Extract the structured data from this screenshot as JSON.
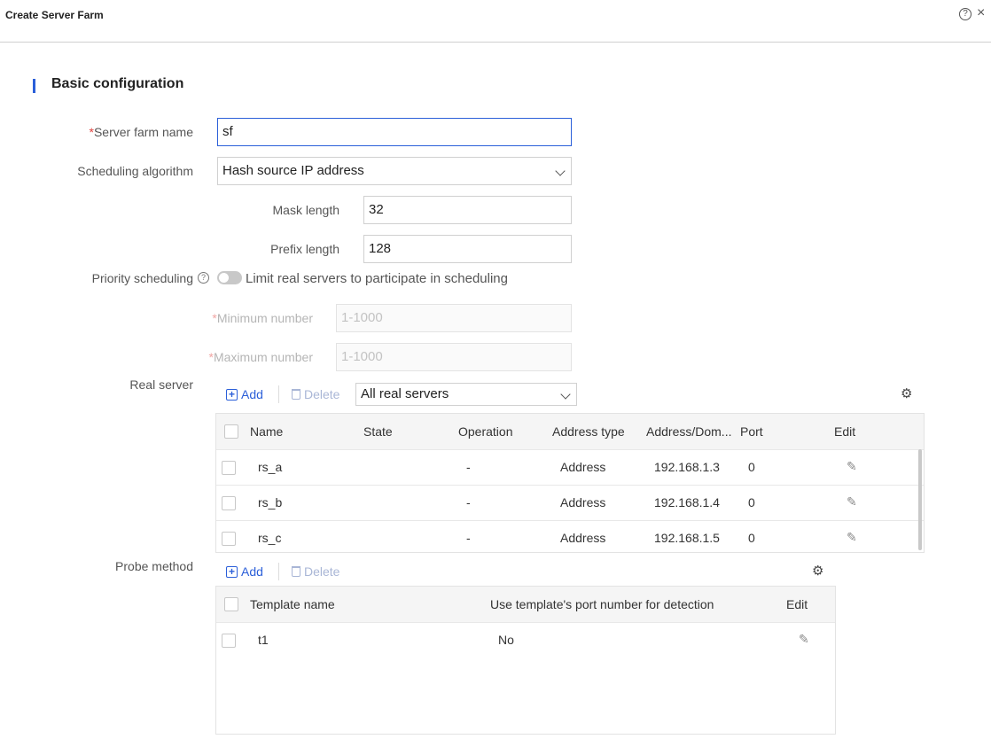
{
  "window": {
    "title": "Create Server Farm",
    "help_icon": "?",
    "close_icon": "×"
  },
  "section": {
    "title": "Basic configuration"
  },
  "form": {
    "server_farm_name": {
      "required_mark": "*",
      "label": "Server farm name",
      "value": "sf"
    },
    "scheduling_algorithm": {
      "label": "Scheduling algorithm",
      "value": "Hash source IP address"
    },
    "mask_length": {
      "label": "Mask length",
      "value": "32"
    },
    "prefix_length": {
      "label": "Prefix length",
      "value": "128"
    },
    "priority_scheduling": {
      "label": "Priority scheduling",
      "help_icon": "?",
      "toggle_text": "Limit real servers to participate in scheduling",
      "enabled": false
    },
    "minimum_number": {
      "required_mark": "*",
      "label": "Minimum number",
      "placeholder": "1-1000"
    },
    "maximum_number": {
      "required_mark": "*",
      "label": "Maximum number",
      "placeholder": "1-1000"
    }
  },
  "real_server": {
    "label": "Real server",
    "add_label": "Add",
    "delete_label": "Delete",
    "filter_value": "All real servers",
    "columns": [
      "Name",
      "State",
      "Operation",
      "Address type",
      "Address/Dom...",
      "Port",
      "Edit"
    ],
    "rows": [
      {
        "name": "rs_a",
        "state": "",
        "operation": "-",
        "address_type": "Address",
        "address": "192.168.1.3",
        "port": "0"
      },
      {
        "name": "rs_b",
        "state": "",
        "operation": "-",
        "address_type": "Address",
        "address": "192.168.1.4",
        "port": "0"
      },
      {
        "name": "rs_c",
        "state": "",
        "operation": "-",
        "address_type": "Address",
        "address": "192.168.1.5",
        "port": "0"
      }
    ]
  },
  "probe_method": {
    "label": "Probe method",
    "add_label": "Add",
    "delete_label": "Delete",
    "columns": [
      "Template name",
      "Use template's port number for detection",
      "Edit"
    ],
    "rows": [
      {
        "template_name": "t1",
        "use_template_port": "No"
      }
    ]
  },
  "colors": {
    "accent": "#2b5fd9",
    "required": "#e0413c"
  }
}
